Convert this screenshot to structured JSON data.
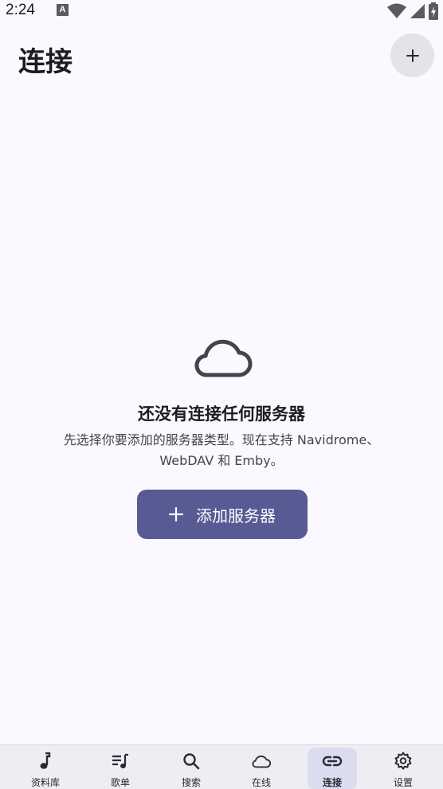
{
  "status_bar": {
    "time": "2:24",
    "notification_icon_letter": "A",
    "icons": [
      "wifi-icon",
      "signal-icon",
      "battery-charging-icon"
    ]
  },
  "header": {
    "title": "连接",
    "add_icon": "plus-icon"
  },
  "empty_state": {
    "icon": "cloud-icon",
    "title": "还没有连接任何服务器",
    "description_line1": "先选择你要添加的服务器类型。现在支持 Navidrome、",
    "description_line2": "WebDAV 和 Emby。",
    "button_label": "添加服务器",
    "button_icon": "plus-icon"
  },
  "bottom_nav": {
    "items": [
      {
        "label": "资料库",
        "icon": "music-note-icon",
        "active": false
      },
      {
        "label": "歌单",
        "icon": "playlist-icon",
        "active": false
      },
      {
        "label": "搜索",
        "icon": "search-icon",
        "active": false
      },
      {
        "label": "在线",
        "icon": "cloud-icon",
        "active": false
      },
      {
        "label": "连接",
        "icon": "link-icon",
        "active": true
      },
      {
        "label": "设置",
        "icon": "gear-icon",
        "active": false
      }
    ]
  },
  "colors": {
    "background": "#fbf8ff",
    "primary_button": "#585a94",
    "nav_background": "#efedf4",
    "nav_active_pill": "#dcdcf0",
    "header_button": "#e5e2ea"
  }
}
